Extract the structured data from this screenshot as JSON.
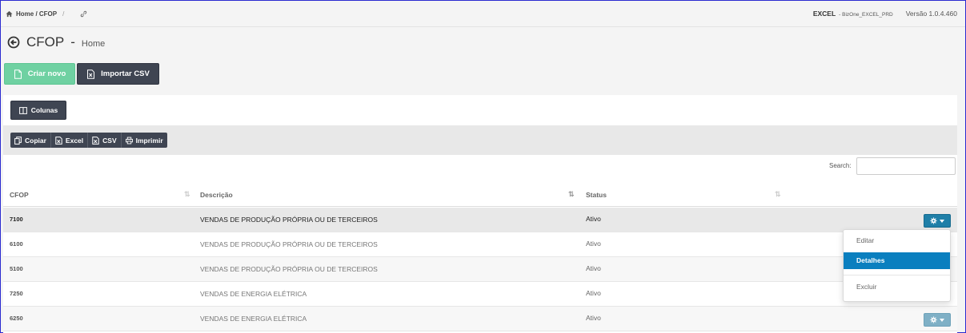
{
  "breadcrumb": {
    "path": "Home / CFOP",
    "sep": "/"
  },
  "env": {
    "name": "EXCEL",
    "sub": "- BizOne_EXCEL_PRD",
    "version": "Versão 1.0.4.460"
  },
  "page": {
    "title": "CFOP",
    "dash": "-",
    "subtitle": "Home"
  },
  "actions": {
    "new_label": "Criar novo",
    "import_label": "Importar CSV",
    "new_color": "#6fd1a2",
    "dark_color": "#3f4552"
  },
  "columns_button": "Colunas",
  "export": [
    "Copiar",
    "Excel",
    "CSV",
    "Imprimir"
  ],
  "search": {
    "label": "Search:",
    "value": ""
  },
  "table": {
    "headers": [
      "CFOP",
      "Descrição",
      "Status"
    ],
    "rows": [
      {
        "cfop": "7100",
        "descricao": "VENDAS DE PRODUÇÃO PRÓPRIA OU DE TERCEIROS",
        "status": "Ativo"
      },
      {
        "cfop": "6100",
        "descricao": "VENDAS DE PRODUÇÃO PRÓPRIA OU DE TERCEIROS",
        "status": "Ativo"
      },
      {
        "cfop": "5100",
        "descricao": "VENDAS DE PRODUÇÃO PRÓPRIA OU DE TERCEIROS",
        "status": "Ativo"
      },
      {
        "cfop": "7250",
        "descricao": "VENDAS DE ENERGIA ELÉTRICA",
        "status": "Ativo"
      },
      {
        "cfop": "6250",
        "descricao": "VENDAS DE ENERGIA ELÉTRICA",
        "status": "Ativo"
      }
    ]
  },
  "row_menu": {
    "items": [
      "Editar",
      "Detalhes",
      "Excluir"
    ],
    "selected": "Detalhes",
    "accent": "#0a7fbf"
  }
}
